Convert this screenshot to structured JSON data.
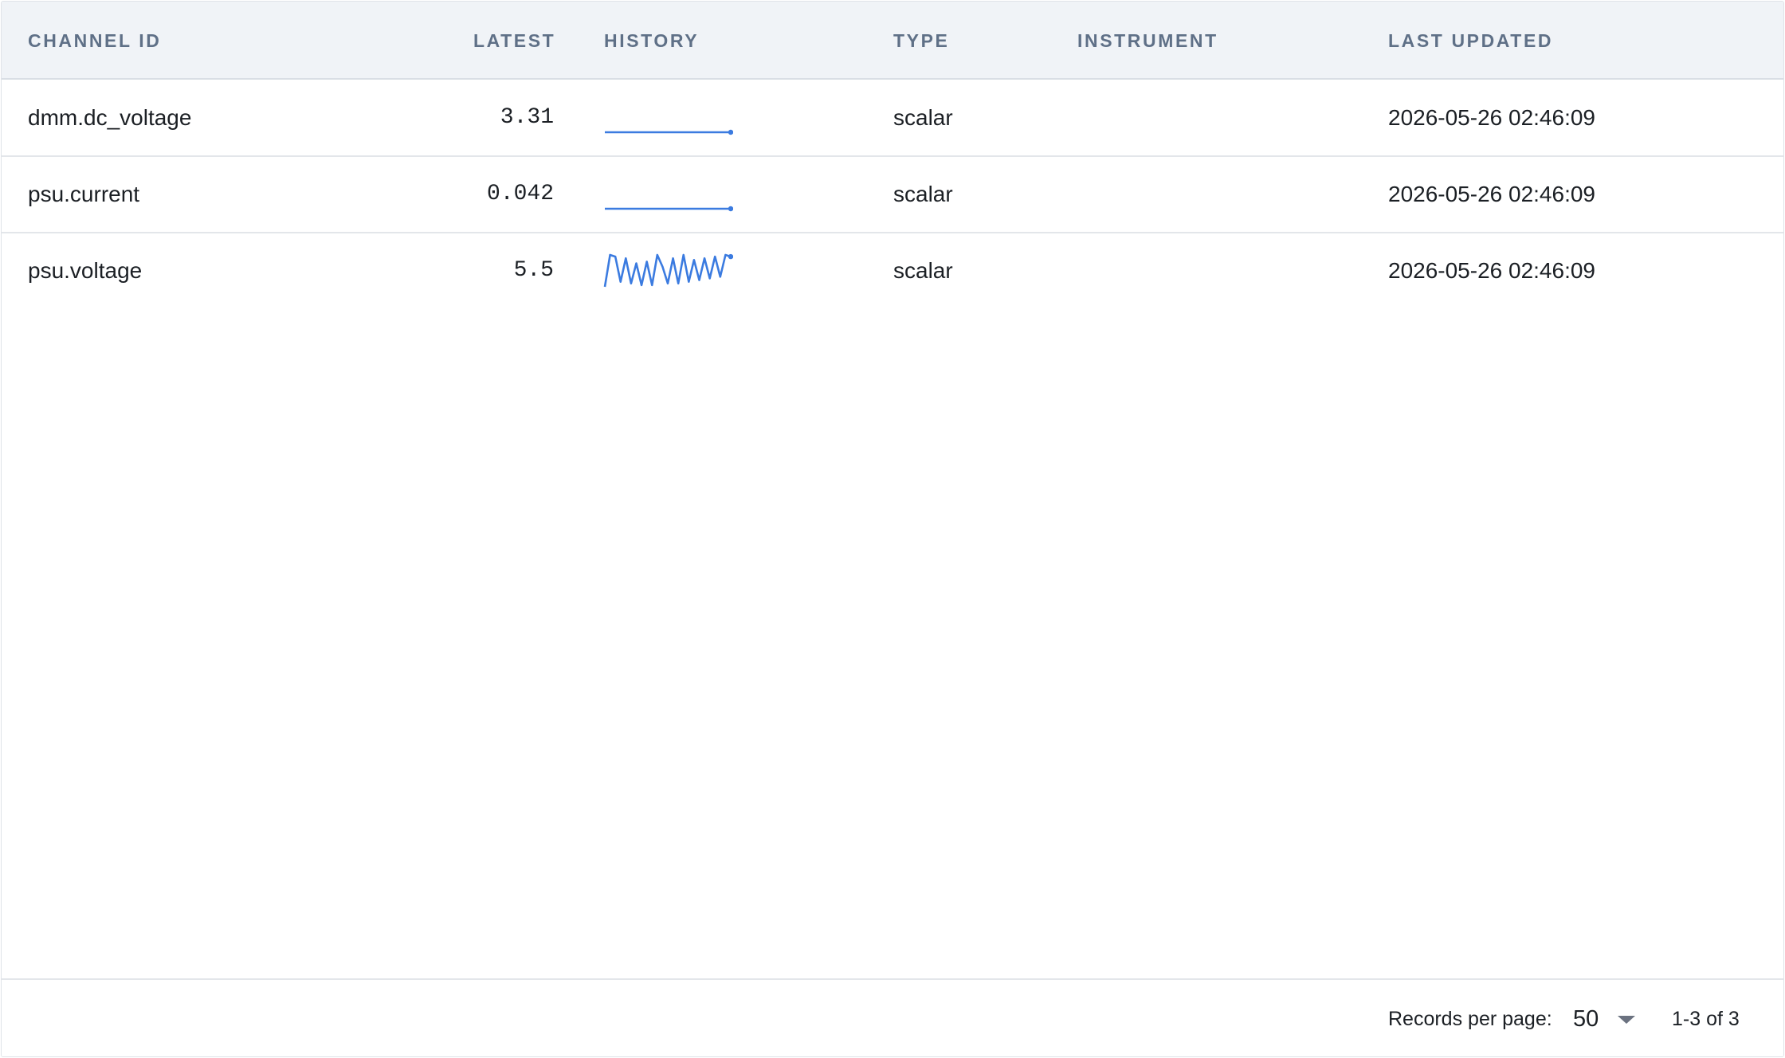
{
  "table": {
    "columns": {
      "channel_id": "CHANNEL ID",
      "latest": "LATEST",
      "history": "HISTORY",
      "type": "TYPE",
      "instrument": "INSTRUMENT",
      "last_updated": "LAST UPDATED"
    },
    "rows": [
      {
        "channel_id": "dmm.dc_voltage",
        "latest": "3.31",
        "history": [
          3.31,
          3.31,
          3.31,
          3.31,
          3.31,
          3.31,
          3.31,
          3.31,
          3.31,
          3.31
        ],
        "type": "scalar",
        "instrument": "",
        "last_updated": "2026-05-26 02:46:09"
      },
      {
        "channel_id": "psu.current",
        "latest": "0.042",
        "history": [
          0.042,
          0.042,
          0.042,
          0.042,
          0.042,
          0.042,
          0.042,
          0.042,
          0.042,
          0.042
        ],
        "type": "scalar",
        "instrument": "",
        "last_updated": "2026-05-26 02:46:09"
      },
      {
        "channel_id": "psu.voltage",
        "latest": "5.5",
        "history": [
          0.0,
          0.95,
          0.9,
          0.15,
          0.85,
          0.1,
          0.7,
          0.05,
          0.75,
          0.05,
          0.95,
          0.6,
          0.1,
          0.85,
          0.1,
          0.95,
          0.15,
          0.8,
          0.2,
          0.85,
          0.25,
          0.9,
          0.3,
          0.95,
          0.9
        ],
        "type": "scalar",
        "instrument": "",
        "last_updated": "2026-05-26 02:46:09"
      }
    ],
    "spark_color": "#3b7be0"
  },
  "footer": {
    "records_label": "Records per page:",
    "records_value": "50",
    "range_text": "1-3 of 3"
  }
}
